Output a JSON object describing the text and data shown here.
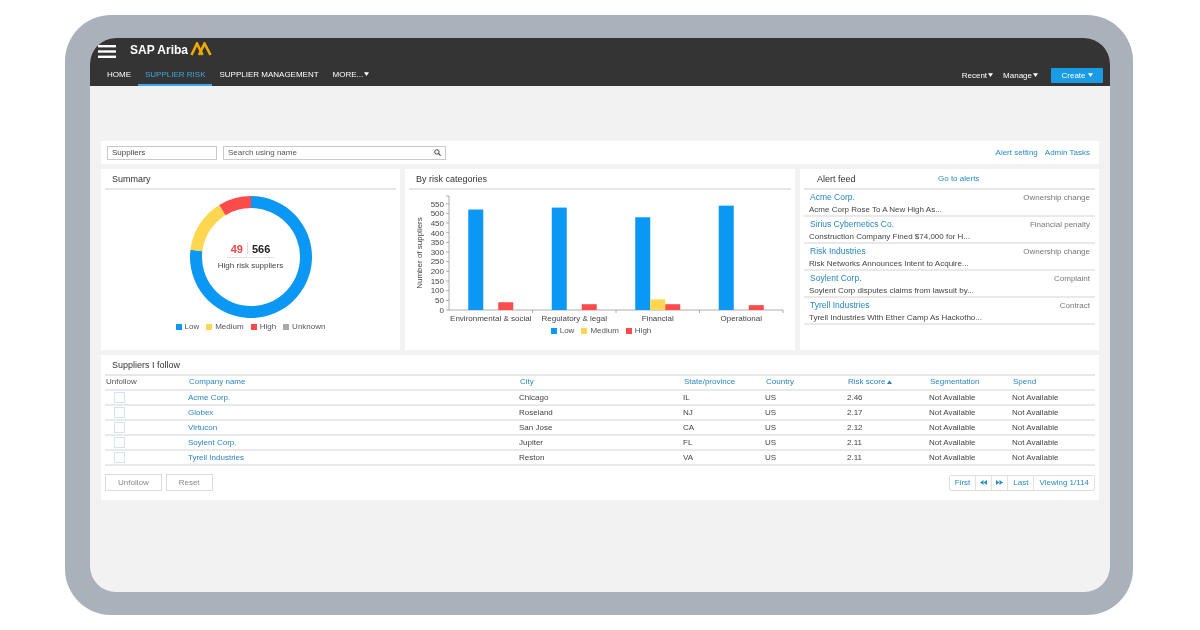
{
  "header": {
    "brand": "SAP Ariba",
    "nav": [
      {
        "label": "HOME",
        "selected": false,
        "menu": false
      },
      {
        "label": "SUPPLIER RISK",
        "selected": true,
        "menu": false
      },
      {
        "label": "SUPPLIER MANAGEMENT",
        "selected": false,
        "menu": false
      },
      {
        "label": "MORE...",
        "selected": false,
        "menu": true
      }
    ],
    "menus": [
      "Recent",
      "Manage"
    ],
    "create_button": "Create"
  },
  "search_bar": {
    "scope_field": {
      "value": "Suppliers"
    },
    "search_field": {
      "placeholder": "Search using name"
    },
    "links": [
      "Alert setting",
      "Admin Tasks"
    ]
  },
  "summary": {
    "title": "Summary",
    "high_risk_count": "49",
    "total_count": "566",
    "caption": "High risk suppliers",
    "chart_data": {
      "type": "donut",
      "categories": [
        "Low",
        "Medium",
        "High",
        "Unknown"
      ],
      "values": [
        76.9,
        14.4,
        8.7,
        0
      ],
      "colors": [
        "#0b97f4",
        "#ffd650",
        "#fd4b4b",
        "#a9a9a9"
      ],
      "legend": "bottom"
    }
  },
  "risk_categories": {
    "title": "By risk categories",
    "chart_data": {
      "type": "bar",
      "categories": [
        "Environmental & social",
        "Regulatory & legal",
        "Financial",
        "Operational"
      ],
      "ylabel": "Number of suppliers",
      "yticks": [
        0,
        50,
        100,
        150,
        200,
        250,
        300,
        350,
        400,
        450,
        500,
        550
      ],
      "ylim": [
        0,
        590
      ],
      "series": [
        {
          "name": "Low",
          "color": "#0b97f4",
          "values": [
            520,
            530,
            480,
            540
          ]
        },
        {
          "name": "Medium",
          "color": "#ffd650",
          "values": [
            0,
            0,
            55,
            0
          ]
        },
        {
          "name": "High",
          "color": "#fd4b4b",
          "values": [
            40,
            30,
            30,
            25
          ]
        }
      ],
      "legend": "bottom"
    }
  },
  "alert_feed": {
    "title": "Alert feed",
    "link": "Go to alerts",
    "items": [
      {
        "company": "Acme Corp.",
        "type": "Ownership change",
        "text": "Acme Corp Rose To A New High As..."
      },
      {
        "company": "Sirius Cybernetics Co.",
        "type": "Financial penalty",
        "text": "Construction Company Fined $74,000 for H..."
      },
      {
        "company": "Risk Industries",
        "type": "Ownership change",
        "text": "Risk Networks Announces Intent to Acquire..."
      },
      {
        "company": "Soylent Corp.",
        "type": "Complaint",
        "text": "Soylent Corp disputes claims from lawsuit by..."
      },
      {
        "company": "Tyrell Industries",
        "type": "Contract",
        "text": "Tyrell Industries With Ether Camp As Hackotho..."
      }
    ]
  },
  "suppliers_followed": {
    "title": "Suppliers I follow",
    "columns": [
      {
        "label": "Unfollow",
        "sortable": false,
        "sorted": false
      },
      {
        "label": "Company name",
        "sortable": true,
        "sorted": false
      },
      {
        "label": "City",
        "sortable": true,
        "sorted": false
      },
      {
        "label": "State/province",
        "sortable": true,
        "sorted": false
      },
      {
        "label": "Country",
        "sortable": true,
        "sorted": false
      },
      {
        "label": "Risk score",
        "sortable": true,
        "sorted": true
      },
      {
        "label": "Segmentation",
        "sortable": true,
        "sorted": false
      },
      {
        "label": "Spend",
        "sortable": true,
        "sorted": false
      }
    ],
    "rows": [
      {
        "checked": false,
        "company": "Acme Corp.",
        "city": "Chicago",
        "state": "IL",
        "country": "US",
        "risk_score": "2.46",
        "segmentation": "Not Available",
        "spend": "Not Available"
      },
      {
        "checked": false,
        "company": "Globex",
        "city": "Roseland",
        "state": "NJ",
        "country": "US",
        "risk_score": "2.17",
        "segmentation": "Not Available",
        "spend": "Not Available"
      },
      {
        "checked": false,
        "company": "Virtucon",
        "city": "San Jose",
        "state": "CA",
        "country": "US",
        "risk_score": "2.12",
        "segmentation": "Not Available",
        "spend": "Not Available"
      },
      {
        "checked": false,
        "company": "Soylent Corp.",
        "city": "Jupiter",
        "state": "FL",
        "country": "US",
        "risk_score": "2.11",
        "segmentation": "Not Available",
        "spend": "Not Available"
      },
      {
        "checked": false,
        "company": "Tyrell Industries",
        "city": "Reston",
        "state": "VA",
        "country": "US",
        "risk_score": "2.11",
        "segmentation": "Not Available",
        "spend": "Not Available"
      }
    ],
    "buttons": [
      "Unfollow",
      "Reset"
    ],
    "pagination": {
      "first": "First",
      "last": "Last",
      "viewing": "Viewing 1/114"
    }
  }
}
